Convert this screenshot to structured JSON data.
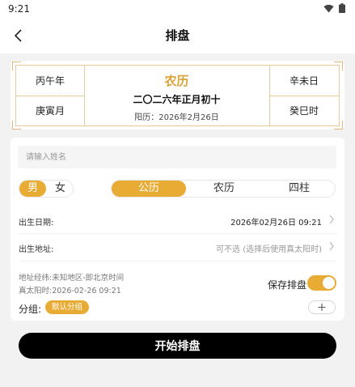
{
  "status_bar": {
    "time": "9:21"
  },
  "appbar": {
    "title": "排盘"
  },
  "bazi": {
    "pillars": [
      "丙午年",
      "庚寅月",
      "辛未日",
      "癸巳时"
    ],
    "calendar_type": "农历",
    "lunar_date": "二〇二六年正月初十",
    "solar_date": "阳历：2026年2月26日"
  },
  "form": {
    "name_placeholder": "请输入姓名",
    "gender_options": [
      "男",
      "女"
    ],
    "calendar_options": [
      "公历",
      "农历",
      "四柱"
    ],
    "birth_date_label": "出生日期:",
    "birth_date_value": "2026年02月26日 09:21",
    "birth_place_label": "出生地址:",
    "birth_place_value": "可不选 (选择后使用真太阳时)",
    "coords_text": "地址经纬:未知地区-即北京时间",
    "true_solar_text": "真太阳时:2026-02-26 09:21",
    "save_label": "保存排盘",
    "group_label": "分组:",
    "group_chip": "默认分组"
  },
  "start_button": "开始排盘",
  "colors": {
    "accent": "#e8ac35",
    "frame": "#e9c99a",
    "button": "#000000"
  }
}
